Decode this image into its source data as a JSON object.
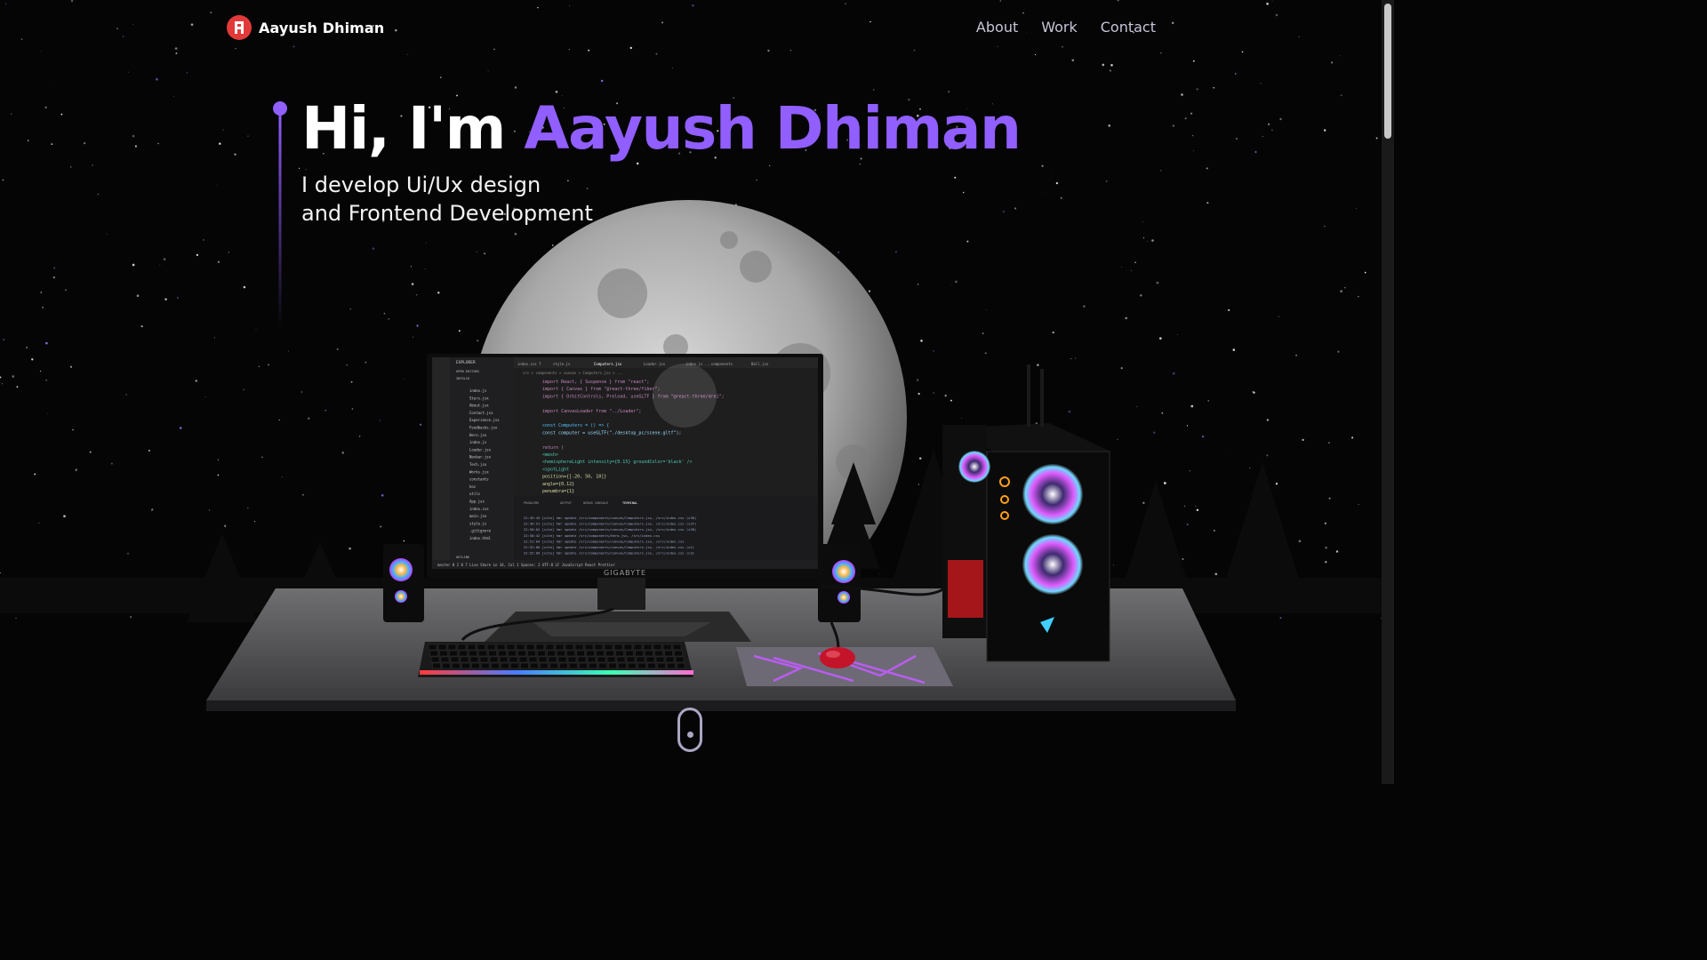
{
  "brand": {
    "name": "Aayush Dhiman"
  },
  "nav": {
    "items": [
      "About",
      "Work",
      "Contact"
    ]
  },
  "hero": {
    "greeting": "Hi, I'm ",
    "name": "Aayush Dhiman",
    "subtitle_line1": "I develop Ui/Ux design",
    "subtitle_line2": "and Frontend Development"
  },
  "monitor": {
    "brand": "GIGABYTE"
  },
  "editor": {
    "sidebar_title": "EXPLORER",
    "sidebar_sections": [
      "OPEN EDITORS",
      "3DFOLIO",
      "OUTLINE"
    ],
    "files": [
      "index.js",
      "Stars.jsx",
      "About.jsx",
      "Contact.jsx",
      "Experience.jsx",
      "Feedbacks.jsx",
      "Hero.jsx",
      "index.js",
      "Loader.jsx",
      "Navbar.jsx",
      "Tech.jsx",
      "Works.jsx",
      "constants",
      "hoc",
      "utils",
      "App.jsx",
      "index.css",
      "main.jsx",
      "style.js",
      ".gitignore",
      "index.html"
    ],
    "tabs": [
      "index.css 7",
      "style.js",
      "Computers.jsx",
      "Loader.jsx",
      "index.js ...components",
      "Ball.jsx"
    ],
    "breadcrumb": "src > components > canvas > Computers.jsx > ...",
    "code": [
      "import React, { Suspense } from \"react\";",
      "import { Canvas } from \"@react-three/fiber\";",
      "import { OrbitControls, Preload, useGLTF } from \"@react-three/drei\";",
      "",
      "import CanvasLoader from \"../Loader\";",
      "",
      "const Computers = () => {",
      "  const computer = useGLTF(\"./desktop_pc/scene.gltf\");",
      "",
      "  return (",
      "    <mesh>",
      "      <hemisphereLight intensity={0.15} groundColor='black' />",
      "      <spotLight",
      "        position={[-20, 50, 10]}",
      "        angle={0.12}",
      "        penumbra={1}"
    ],
    "panel_tabs": [
      "PROBLEMS",
      "OUTPUT",
      "DEBUG CONSOLE",
      "TERMINAL"
    ],
    "terminal": [
      "22:49:45 [vite] hmr update /src/components/canvas/Computers.jsx, /src/index.css (x36)",
      "22:49:51 [vite] hmr update /src/components/canvas/Computers.jsx, /src/index.css (x37)",
      "22:50:02 [vite] hmr update /src/components/canvas/Computers.jsx, /src/index.css (x38)",
      "22:50:42 [vite] hmr update /src/components/Hero.jsx, /src/index.css",
      "22:51:04 [vite] hmr update /src/components/canvas/Computers.jsx, /src/index.css",
      "22:52:06 [vite] hmr update /src/components/canvas/Computers.jsx, /src/index.css (x2)",
      "22:52:09 [vite] hmr update /src/components/canvas/Computers.jsx, /src/index.css (x3)"
    ],
    "status_bar": "master  0 2  0 7  Live Share     Ln 34, Col 1  Spaces: 2  UTF-8  LF  JavaScript React  Prettier"
  },
  "colors": {
    "accent": "#915eff",
    "logo": "#e23a3a",
    "background": "#050505"
  },
  "icons": {
    "logo": "logo-mark-icon",
    "scroll": "scroll-mouse-icon"
  }
}
